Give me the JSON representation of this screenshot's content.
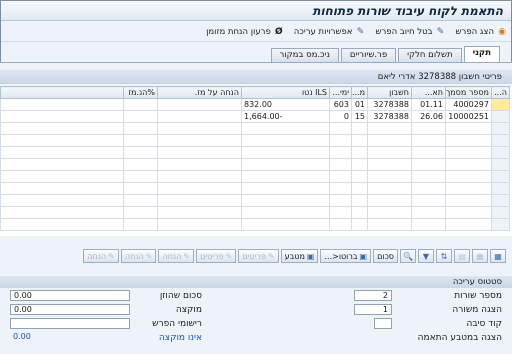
{
  "window": {
    "title": "התאמת לקוח עיבוד שורות פתוחות"
  },
  "toolbar": {
    "items": [
      {
        "label": "הצג הפרש",
        "icon": "display-diff-icon"
      },
      {
        "label": "בטל חיוב הפרש",
        "icon": "cancel-icon"
      },
      {
        "label": "אפשרויות עריכה",
        "icon": "pencil-icon"
      },
      {
        "label": "פרעון הנחת מזומן",
        "icon": "strike-icon"
      }
    ]
  },
  "tabs": [
    "תקני",
    "תשלום חלקי",
    "פר.שיוריים",
    "ניכ.מס במקור"
  ],
  "grid": {
    "title": "פריטי חשבון 3278388 אדרי ליאם",
    "columns": [
      "ה...",
      "מספר מסמך",
      "תא...",
      "חשבון",
      "מ...",
      "ימי...",
      "ILS נטו",
      "הנחה על מז.",
      "%הנ.מז"
    ],
    "rows": [
      {
        "doc": "4000297",
        "date": "01.11",
        "account": "3278388",
        "m": "01",
        "days": "603",
        "net": "832.00",
        "disc": "",
        "pct": ""
      },
      {
        "doc": "10000251",
        "date": "26.06",
        "account": "3278388",
        "m": "15",
        "days": "0",
        "net": "-1,664.00",
        "disc": "",
        "pct": ""
      }
    ]
  },
  "buttons": {
    "sum": "סכום",
    "gross": "ברוטו<...",
    "currency": "מטבע",
    "items1": "פריטים",
    "items2": "פריטים",
    "discount1": "הנחה",
    "discount2": "הנחה",
    "discount3": "הנחה"
  },
  "status": {
    "title": "סטטוס עריכה",
    "lines_label": "מספר שורות",
    "lines_value": "2",
    "shown_label": "הצגה משורה",
    "shown_value": "1",
    "reason_label": "קוד סיבה",
    "reason_value": "",
    "currency_label": "הצגה במטבע התאמה",
    "entered_label": "סכום שהוזן",
    "entered_value": "0.00",
    "assigned_label": "מוקצה",
    "assigned_value": "0.00",
    "diff_label": "רישומי הפרש",
    "diff_value": "",
    "unassigned_label": "אינו מוקצה",
    "unassigned_value": "0.00"
  }
}
